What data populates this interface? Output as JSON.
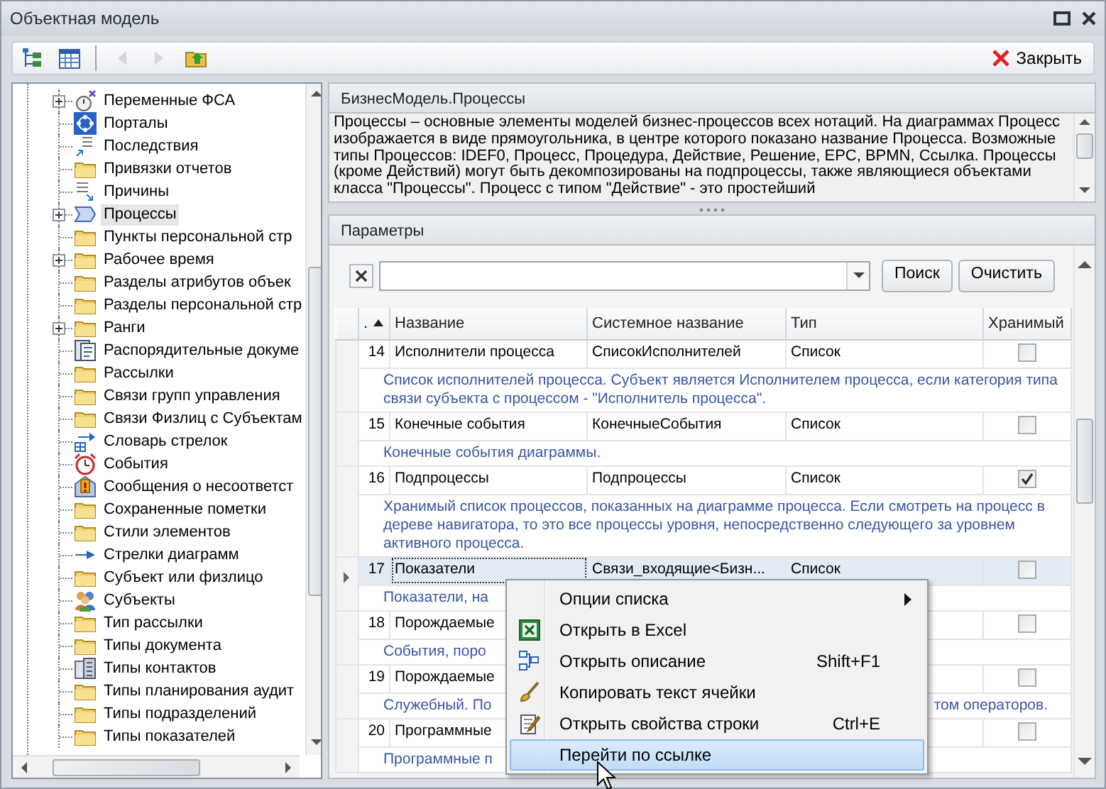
{
  "window": {
    "title": "Объектная модель"
  },
  "toolbar": {
    "buttons": [
      {
        "kind": "tree",
        "disabled": false
      },
      {
        "kind": "table",
        "disabled": false
      },
      {
        "kind": "back",
        "disabled": true
      },
      {
        "kind": "forward",
        "disabled": true
      },
      {
        "kind": "folder-up",
        "disabled": false
      }
    ],
    "close_label": "Закрыть"
  },
  "tree": {
    "items": [
      {
        "label": "Переменные ФСА",
        "kind": "stopwatch",
        "expanded": false,
        "selected": false
      },
      {
        "label": "Порталы",
        "kind": "portal",
        "selected": false
      },
      {
        "label": "Последствия",
        "kind": "list-out",
        "selected": false
      },
      {
        "label": "Привязки отчетов",
        "kind": "folder",
        "selected": false
      },
      {
        "label": "Причины",
        "kind": "list-in",
        "selected": false
      },
      {
        "label": "Процессы",
        "kind": "process",
        "expanded": false,
        "selected": true
      },
      {
        "label": "Пункты персональной стр",
        "kind": "folder",
        "selected": false
      },
      {
        "label": "Рабочее время",
        "kind": "folder",
        "expanded": false,
        "selected": false
      },
      {
        "label": "Разделы атрибутов объек",
        "kind": "folder",
        "selected": false
      },
      {
        "label": "Разделы персональной стр",
        "kind": "folder",
        "selected": false
      },
      {
        "label": "Ранги",
        "kind": "folder",
        "expanded": false,
        "selected": false
      },
      {
        "label": "Распорядительные докуме",
        "kind": "document",
        "selected": false
      },
      {
        "label": "Рассылки",
        "kind": "folder",
        "selected": false
      },
      {
        "label": "Связи групп управления",
        "kind": "folder",
        "selected": false
      },
      {
        "label": "Связи Физлиц с Субъектам",
        "kind": "folder",
        "selected": false
      },
      {
        "label": "Словарь стрелок",
        "kind": "arrow-table",
        "selected": false
      },
      {
        "label": "События",
        "kind": "alarm",
        "selected": false
      },
      {
        "label": "Сообщения о несоответст",
        "kind": "warning-mail",
        "selected": false
      },
      {
        "label": "Сохраненные пометки",
        "kind": "folder",
        "selected": false
      },
      {
        "label": "Стили элементов",
        "kind": "folder",
        "selected": false
      },
      {
        "label": "Стрелки диаграмм",
        "kind": "arrow",
        "selected": false
      },
      {
        "label": "Субъект или физлицо",
        "kind": "folder",
        "selected": false
      },
      {
        "label": "Субъекты",
        "kind": "people",
        "selected": false
      },
      {
        "label": "Тип рассылки",
        "kind": "folder",
        "selected": false
      },
      {
        "label": "Типы документа",
        "kind": "folder",
        "selected": false
      },
      {
        "label": "Типы контактов",
        "kind": "contacts",
        "selected": false
      },
      {
        "label": "Типы планирования аудит",
        "kind": "folder",
        "selected": false
      },
      {
        "label": "Типы подразделений",
        "kind": "folder",
        "selected": false
      },
      {
        "label": "Типы показателей",
        "kind": "folder",
        "selected": false
      }
    ]
  },
  "details": {
    "title": "БизнесМодель.Процессы",
    "description": "Процессы – основные элементы моделей бизнес-процессов всех нотаций. На диаграммах Процесс изображается в виде прямоугольника, в центре которого показано название Процесса. Возможные типы Процессов: IDEF0, Процесс, Процедура, Действие, Решение, EPC, BPMN, Ссылка. Процессы (кроме Действий) могут быть декомпозированы на подпроцессы, также являющиеся объектами класса \"Процессы\". Процесс с типом \"Действие\" - это простейший"
  },
  "parameters": {
    "title": "Параметры",
    "search_button": "Поиск",
    "clear_button": "Очистить",
    "columns": [
      {
        "label": ".",
        "sorted": true
      },
      {
        "label": "Название",
        "sorted": false
      },
      {
        "label": "Системное название",
        "sorted": false
      },
      {
        "label": "Тип",
        "sorted": false
      },
      {
        "label": "Хранимый",
        "sorted": false
      }
    ],
    "rows": [
      {
        "number": "14",
        "name": "Исполнители процесса",
        "system_name": "СписокИсполнителей",
        "type": "Список",
        "stored": false,
        "selected": false,
        "description": [
          "Список исполнителей процесса. Субъект является Исполнителем процесса, если категория типа связи субъекта с процессом - \"Исполнитель процесса\"."
        ]
      },
      {
        "number": "15",
        "name": "Конечные события",
        "system_name": "КонечныеСобытия",
        "type": "Список",
        "stored": false,
        "selected": false,
        "description": [
          "Конечные события диаграммы."
        ]
      },
      {
        "number": "16",
        "name": "Подпроцессы",
        "system_name": "Подпроцессы",
        "type": "Список",
        "stored": true,
        "selected": false,
        "description": [
          "Хранимый список процессов, показанных на диаграмме процесса. Если смотреть на процесс в дереве навигатора, то это все процессы уровня, непосредственно следующего за уровнем активного процесса."
        ]
      },
      {
        "number": "17",
        "name": "Показатели",
        "system_name": "Связи_входящие<Бизн...",
        "type": "Список",
        "stored": false,
        "selected": true,
        "description": [
          "Показатели, на"
        ]
      },
      {
        "number": "18",
        "name": "Порождаемые",
        "stored": false,
        "selected": false,
        "description": [
          "События, поро"
        ]
      },
      {
        "number": "19",
        "name": "Порождаемые",
        "stored": false,
        "selected": false,
        "description": [
          "Служебный. По",
          "том операторов."
        ]
      },
      {
        "number": "20",
        "name": "Программные",
        "stored": false,
        "selected": false,
        "description": [
          "Программные п"
        ]
      }
    ]
  },
  "context_menu": {
    "items": [
      {
        "label": "Опции списка",
        "kind": "plain",
        "submenu": true,
        "selected": false
      },
      {
        "label": "Открыть в Excel",
        "kind": "excel",
        "submenu": false,
        "selected": false
      },
      {
        "label": "Открыть описание",
        "kind": "description",
        "shortcut": "Shift+F1",
        "submenu": false,
        "selected": false
      },
      {
        "label": "Копировать текст ячейки",
        "kind": "brush",
        "submenu": false,
        "selected": false
      },
      {
        "label": "Открыть свойства строки",
        "kind": "properties",
        "shortcut": "Ctrl+E",
        "submenu": false,
        "selected": false
      },
      {
        "label": "Перейти по ссылке",
        "kind": "plain",
        "submenu": false,
        "selected": true
      }
    ]
  }
}
